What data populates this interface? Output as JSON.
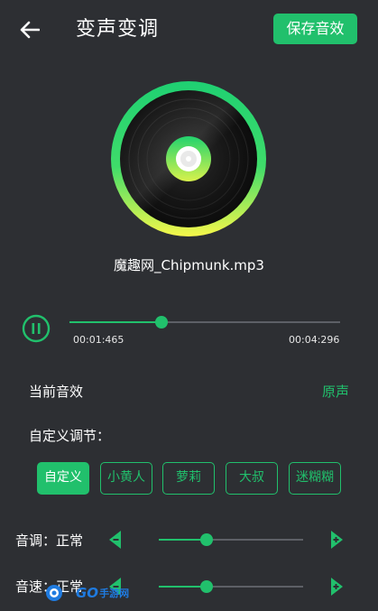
{
  "header": {
    "back_icon": "arrow-left-icon",
    "title": "变声变调",
    "save_label": "保存音效"
  },
  "player": {
    "file_name": "魔趣网_Chipmunk.mp3",
    "current_time": "00:01:465",
    "total_time": "00:04:296",
    "progress": 0.34,
    "state_icon": "pause-icon"
  },
  "effects": {
    "current_label": "当前音效",
    "current_value": "原声",
    "custom_label": "自定义调节：",
    "presets": [
      {
        "label": "自定义",
        "active": true
      },
      {
        "label": "小黄人",
        "active": false
      },
      {
        "label": "萝莉",
        "active": false
      },
      {
        "label": "大叔",
        "active": false
      },
      {
        "label": "迷糊糊",
        "active": false
      }
    ]
  },
  "adjust": {
    "pitch": {
      "label": "音调：正常",
      "level": 0.33
    },
    "speed": {
      "label": "音速：正常",
      "level": 0.33
    }
  },
  "watermark": {
    "text": "GO",
    "sub": "手游网"
  },
  "colors": {
    "accent": "#21c06c",
    "background": "#2d2f33",
    "ring_gradient": [
      "#1fd072",
      "#f6f74a"
    ]
  }
}
